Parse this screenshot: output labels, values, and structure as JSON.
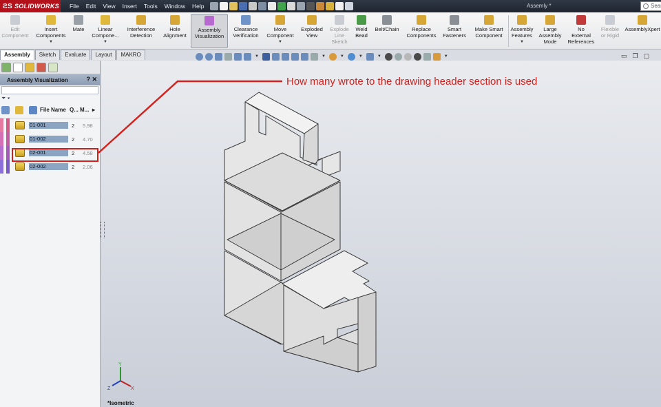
{
  "app": {
    "name": "SOLIDWORKS",
    "document_title": "Assemly *",
    "search_placeholder": "Sear"
  },
  "menu": [
    "File",
    "Edit",
    "View",
    "Insert",
    "Tools",
    "Window",
    "Help"
  ],
  "commands": [
    {
      "label": "Edit\nComponent",
      "enabled": false
    },
    {
      "label": "Insert\nComponents",
      "enabled": true,
      "dropdown": true
    },
    {
      "label": "Mate",
      "enabled": true
    },
    {
      "label": "Linear\nCompone...",
      "enabled": true,
      "dropdown": true
    },
    {
      "label": "Interference\nDetection",
      "enabled": true
    },
    {
      "label": "Hole\nAlignment",
      "enabled": true
    },
    {
      "label": "Assembly\nVisualization",
      "enabled": true,
      "active": true
    },
    {
      "label": "Clearance\nVerification",
      "enabled": true
    },
    {
      "label": "Move\nComponent",
      "enabled": true,
      "dropdown": true
    },
    {
      "label": "Exploded\nView",
      "enabled": true
    },
    {
      "label": "Explode\nLine\nSketch",
      "enabled": false
    },
    {
      "label": "Weld\nBead",
      "enabled": true
    },
    {
      "label": "Belt/Chain",
      "enabled": true
    },
    {
      "label": "Replace\nComponents",
      "enabled": true
    },
    {
      "label": "Smart\nFasteners",
      "enabled": true
    },
    {
      "label": "Make Smart\nComponent",
      "enabled": true
    },
    {
      "label": "Assembly\nFeatures",
      "enabled": true,
      "dropdown": true
    },
    {
      "label": "Large\nAssembly\nMode",
      "enabled": true
    },
    {
      "label": "No\nExternal\nReferences",
      "enabled": true
    },
    {
      "label": "Flexible\nor Rigid",
      "enabled": false
    },
    {
      "label": "AssemblyXpert",
      "enabled": true
    }
  ],
  "tabs": [
    "Assembly",
    "Sketch",
    "Evaluate",
    "Layout",
    "MAKRO"
  ],
  "panel": {
    "title": "Assembly Visualization",
    "columns": {
      "file_name": "File Name",
      "quantity": "Q...",
      "mass": "M..."
    },
    "rows": [
      {
        "name": "01-001",
        "qty": "2",
        "mass": "5.98",
        "color": "#d45a86"
      },
      {
        "name": "01-002",
        "qty": "2",
        "mass": "4.70",
        "color": "#c45aa0"
      },
      {
        "name": "02-001",
        "qty": "2",
        "mass": "4.58",
        "color": "#a45ab8"
      },
      {
        "name": "02-002",
        "qty": "2",
        "mass": "2.06",
        "color": "#7a5ac8"
      }
    ],
    "highlighted_row": "02-001"
  },
  "annotation": {
    "text": "How many wrote to the drawing header section is used",
    "color": "#d3211c"
  },
  "view": {
    "orientation_label": "*Isometric",
    "triad_axes": [
      "Y",
      "Z",
      "X"
    ]
  }
}
